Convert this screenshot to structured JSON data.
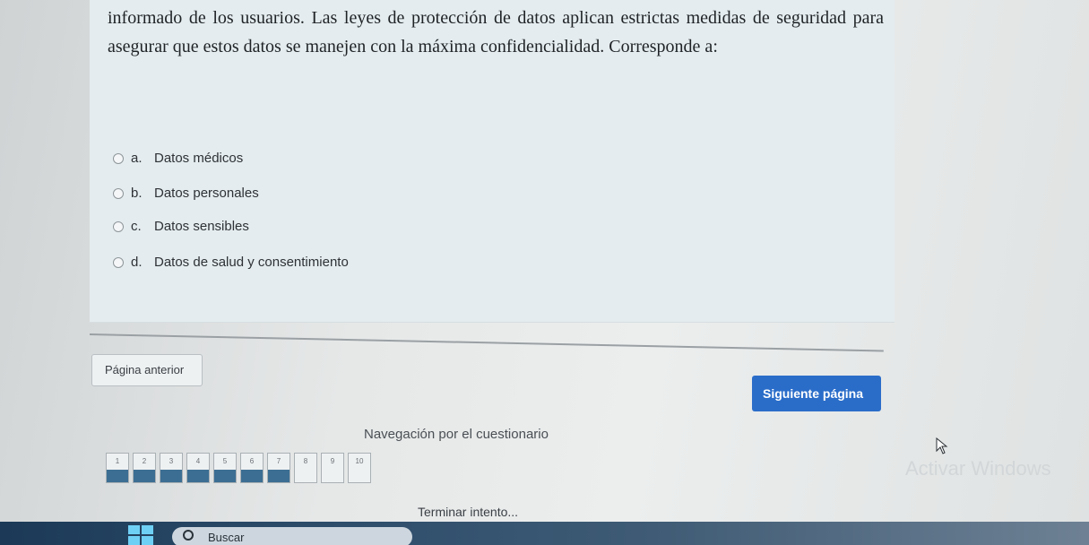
{
  "question": {
    "text": "informado de los usuarios. Las leyes de protección de datos aplican estrictas medidas de seguridad para asegurar que estos datos se manejen con la máxima confidencialidad. Corresponde a:",
    "answers": [
      {
        "letter": "a.",
        "label": "Datos médicos"
      },
      {
        "letter": "b.",
        "label": "Datos personales"
      },
      {
        "letter": "c.",
        "label": "Datos sensibles"
      },
      {
        "letter": "d.",
        "label": "Datos de salud y consentimiento"
      }
    ]
  },
  "navigation": {
    "prev_label": "Página anterior",
    "next_label": "Siguiente página",
    "quiz_nav_title": "Navegación por el cuestionario",
    "finish_label": "Terminar intento...",
    "pages": [
      {
        "num": "1",
        "answered": true
      },
      {
        "num": "2",
        "answered": true
      },
      {
        "num": "3",
        "answered": true
      },
      {
        "num": "4",
        "answered": true
      },
      {
        "num": "5",
        "answered": true
      },
      {
        "num": "6",
        "answered": true
      },
      {
        "num": "7",
        "answered": true
      },
      {
        "num": "8",
        "answered": false
      },
      {
        "num": "9",
        "answered": false
      },
      {
        "num": "10",
        "answered": false
      }
    ]
  },
  "taskbar": {
    "search_label": "Buscar"
  },
  "watermark": "Activar Windows",
  "colors": {
    "accent": "#2a6dc9",
    "answered": "#3c6e93"
  }
}
